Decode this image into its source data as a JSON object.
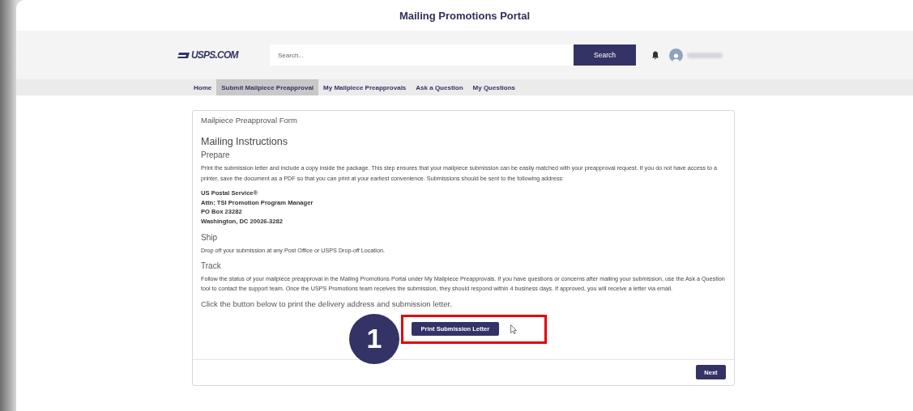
{
  "window": {
    "title": "Mailing Promotions Portal"
  },
  "header": {
    "logo": "USPS.COM",
    "search": {
      "placeholder": "Search..."
    },
    "search_button": "Search"
  },
  "nav": [
    {
      "label": "Home",
      "selected": false
    },
    {
      "label": "Submit Mailpiece Preapproval",
      "selected": true
    },
    {
      "label": "My Mailpiece Preapprovals",
      "selected": false
    },
    {
      "label": "Ask a Question",
      "selected": false
    },
    {
      "label": "My Questions",
      "selected": false
    }
  ],
  "form": {
    "title": "Mailpiece Preapproval Form",
    "heading": "Mailing Instructions",
    "sections": [
      {
        "title": "Prepare",
        "text": "Print the submission letter and include a copy inside the package. This step ensures that your mailpiece submission can be easily matched with your preapproval request. If you do not have access to a printer, save the document as a PDF so that you can print at your earliest convenience. Submissions should be sent to the following address:",
        "address": [
          "US Postal Service®",
          "Attn: TSI Promotion Program Manager",
          "PO Box 23282",
          "Washington, DC 20026-3282"
        ]
      },
      {
        "title": "Ship",
        "text": "Drop off your submission at any Post Office or USPS Drop-off Location."
      },
      {
        "title": "Track",
        "text": "Follow the status of your mailpiece preapproval in the Mailing Promotions Portal under My Mailpiece Preapprovals. If you have questions or concerns after mailing your submission, use the Ask a Question tool to contact the support team. Once the USPS Promotions team receives the submission, they should respond within 4 business days. If approved, you will receive a letter via email."
      }
    ],
    "prompt": "Click the button below to print the delivery address and submission letter.",
    "print_button": "Print Submission Letter",
    "step_badge": "1",
    "next_button": "Next"
  }
}
